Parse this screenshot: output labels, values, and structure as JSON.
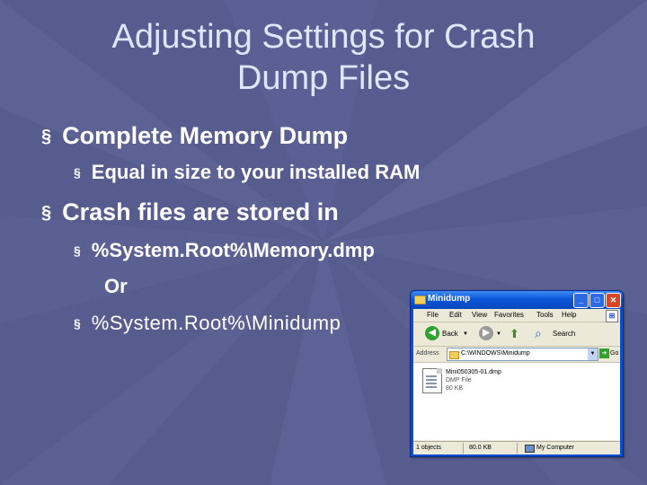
{
  "slide": {
    "title_line1": "Adjusting Settings for Crash",
    "title_line2": "Dump Files",
    "bullet_char": "§",
    "bullets": [
      {
        "level": 1,
        "text": "Complete Memory Dump"
      },
      {
        "level": 2,
        "text": "Equal in size to your installed RAM"
      },
      {
        "level": 1,
        "text": "Crash files are stored in"
      },
      {
        "level": 2,
        "text": "%System.Root%\\Memory.dmp"
      },
      {
        "level": 2,
        "text": "%System.Root%\\Minidump"
      }
    ],
    "or_text": "Or"
  },
  "explorer": {
    "title": "Minidump",
    "menu": [
      "File",
      "Edit",
      "View",
      "Favorites",
      "Tools",
      "Help"
    ],
    "back_label": "Back",
    "search_label": "Search",
    "address_label": "Address",
    "address_value": "C:\\WINDOWS\\Minidump",
    "go_label": "Go",
    "file": {
      "name": "Mini050305-01.dmp",
      "type": "DMP File",
      "size": "80 KB"
    },
    "status": {
      "objects": "1 objects",
      "size": "80.0 KB",
      "location": "My Computer"
    }
  },
  "colors": {
    "background": "#565c8e",
    "title": "#dfe6ff",
    "text": "#ffffff",
    "xp_blue": "#0a56d8"
  }
}
